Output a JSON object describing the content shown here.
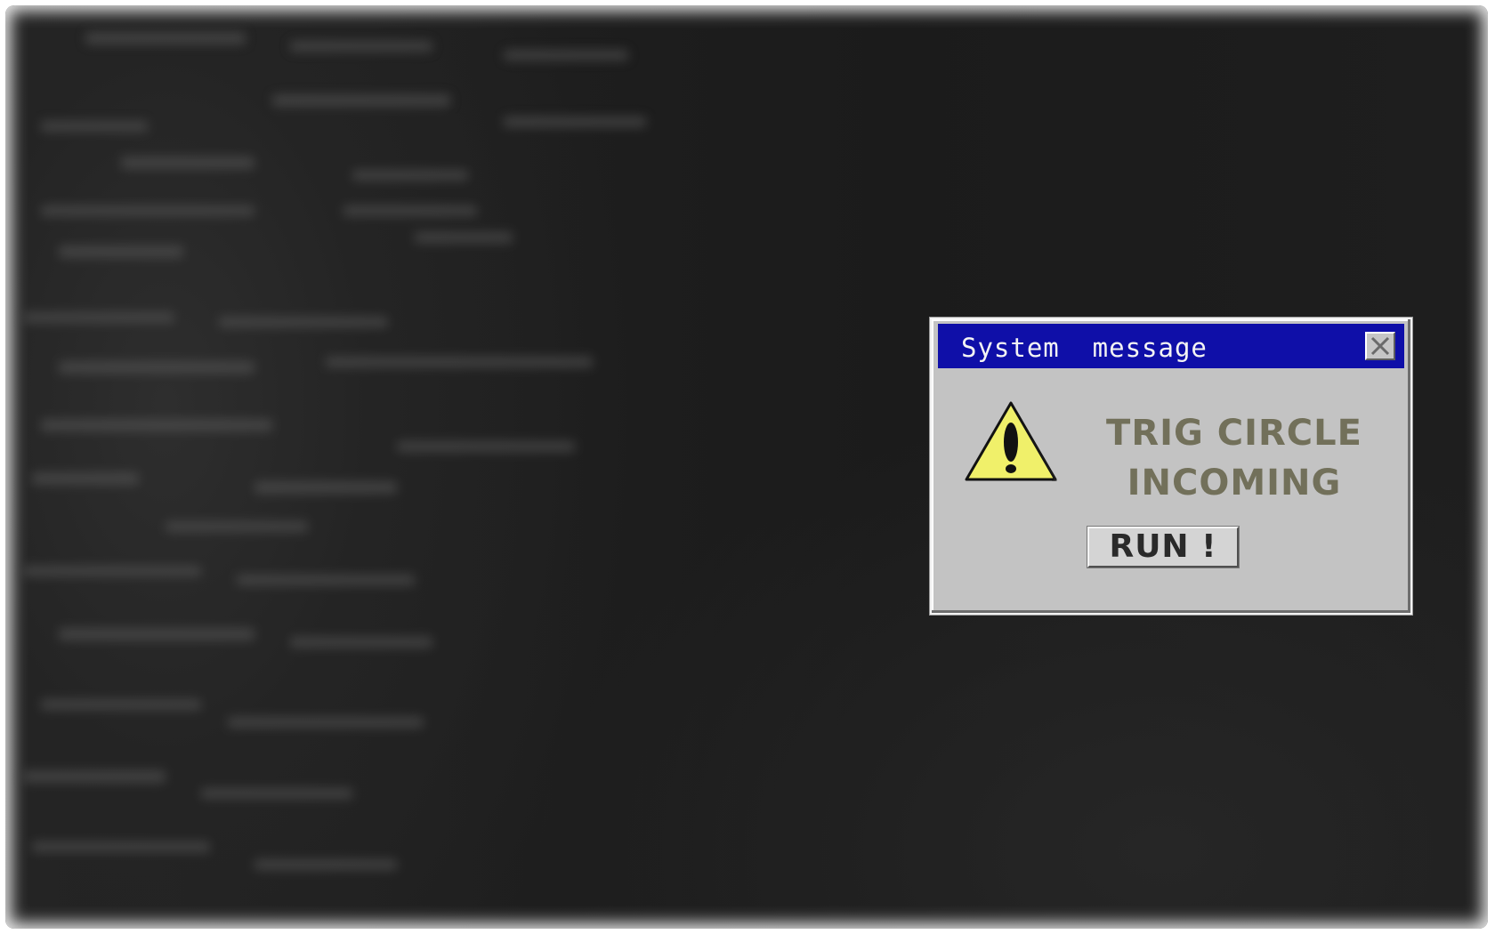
{
  "dialog": {
    "title": "System  message",
    "message_line1": "TRIG CIRCLE",
    "message_line2": "INCOMING",
    "button_label": "RUN !",
    "close_icon": "close-icon",
    "warning_icon": "warning-icon"
  },
  "colors": {
    "titlebar": "#0f0fa8",
    "dialog_bg": "#c3c3c3",
    "message_text": "#72705a",
    "warning_fill": "#f0f06a",
    "backdrop": "#1e1e1e"
  }
}
